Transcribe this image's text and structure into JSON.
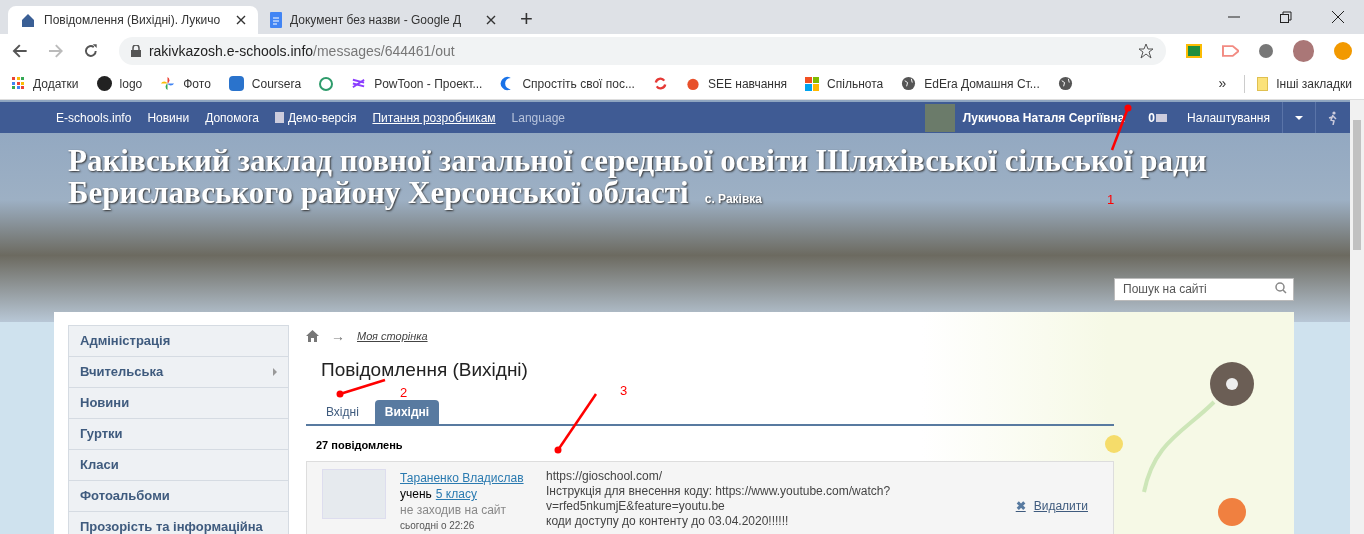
{
  "browser": {
    "tabs": [
      {
        "title": "Повідомлення (Вихідні). Лукичо",
        "selected": true,
        "kind": "house"
      },
      {
        "title": "Документ без назви - Google Д",
        "selected": false,
        "kind": "doc"
      }
    ],
    "new_tab": "+",
    "url_host": "rakivkazosh.e-schools.info",
    "url_path": "/messages/644461/out",
    "bookmarks": [
      {
        "label": "Додатки",
        "kind": "apps"
      },
      {
        "label": "logo",
        "kind": "m"
      },
      {
        "label": "Фото",
        "kind": "photos"
      },
      {
        "label": "Coursera",
        "kind": "co"
      },
      {
        "kind": "face"
      },
      {
        "label": "PowToon - Проект...",
        "kind": "wave"
      },
      {
        "label": "Спростіть свої пос...",
        "kind": "c"
      },
      {
        "kind": "sync"
      },
      {
        "label": "SEE навчання",
        "kind": "apple"
      },
      {
        "label": "Спільнота",
        "kind": "ms"
      },
      {
        "label": "EdEra Домашня Ст...",
        "kind": "globe"
      },
      {
        "kind": "globe"
      }
    ],
    "more": "»",
    "other_bookmarks": "Інші закладки"
  },
  "site_nav": {
    "links": [
      {
        "label": "E-schools.info",
        "underlined": false,
        "muted": false
      },
      {
        "label": "Новини",
        "underlined": false,
        "muted": false
      },
      {
        "label": "Допомога",
        "underlined": false,
        "muted": false
      },
      {
        "label": "Демо-версія",
        "underlined": false,
        "muted": false
      },
      {
        "label": "Питання розробникам",
        "underlined": true,
        "muted": false
      },
      {
        "label": "Language",
        "underlined": false,
        "muted": true
      }
    ],
    "user_name": "Лукичова Наталя Сергіївна",
    "messages_count": "0",
    "settings": "Налаштування"
  },
  "banner": {
    "title_lines": [
      "Раківський заклад повної загальної середньої освіти Шляхівської сільської ради",
      "Бериславського району Херсонської області"
    ],
    "village": "с. Ракiвка",
    "search_placeholder": "Пошук на сайті"
  },
  "sidebar": {
    "items": [
      {
        "label": "Адміністрація",
        "has_submenu": false
      },
      {
        "label": "Вчительська",
        "has_submenu": true
      },
      {
        "label": "Новини",
        "has_submenu": false
      },
      {
        "label": "Гуртки",
        "has_submenu": false
      },
      {
        "label": "Класи",
        "has_submenu": false
      },
      {
        "label": "Фотоальбоми",
        "has_submenu": false
      },
      {
        "label": "Прозорість та інформаційна",
        "has_submenu": false
      }
    ]
  },
  "breadcrumb": {
    "arrow": "→",
    "link": "Моя сторінка"
  },
  "page_title": "Повідомлення (Вихідні)",
  "tabs": [
    {
      "label": "Вхідні",
      "selected": false
    },
    {
      "label": "Вихідні",
      "selected": true
    }
  ],
  "count": "27 повідомлень",
  "messages": [
    {
      "recipient": "Тараненко Владислав",
      "role": "учень",
      "class_link": "5 класу",
      "last_seen": "не заходив на сайт",
      "time": "сьогодні о 22:26",
      "lines": [
        "https://gioschool.com/",
        "Інструкція для внесення коду: https://www.youtube.com/watch?",
        "v=rfed5nkumjE&feature=youtu.be",
        "коди доступу до контенту до 03.04.2020!!!!!!"
      ],
      "delete_icon": "✖",
      "delete": "Видалити"
    }
  ],
  "annotations": [
    {
      "number": "1",
      "color": "#ff0000"
    },
    {
      "number": "2",
      "color": "#ff0000"
    },
    {
      "number": "3",
      "color": "#ff0000"
    }
  ]
}
